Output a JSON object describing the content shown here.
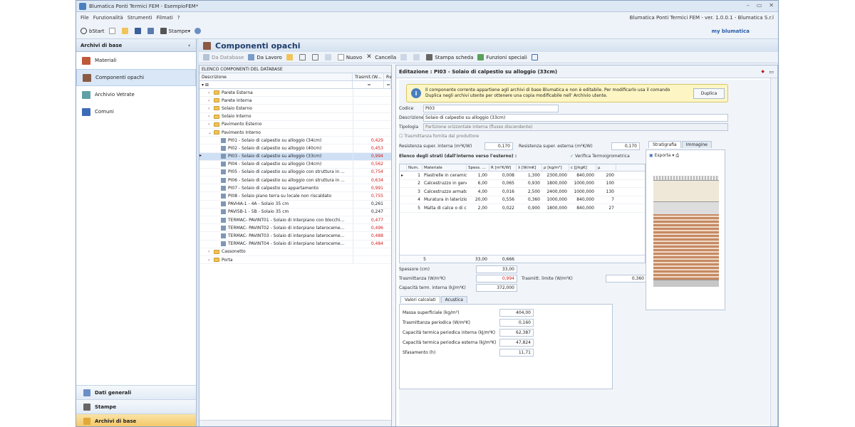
{
  "window": {
    "title": "Blumatica Ponti Termici FEM - EsempioFEM*",
    "app_info": "Blumatica Ponti Termici FEM - ver. 1.0.0.1 - Blumatica S.r.l"
  },
  "menu": [
    "File",
    "Funzionalità",
    "Strumenti",
    "Filmati",
    "?"
  ],
  "toolbar": {
    "bstart": "bStart",
    "stampe": "Stampe",
    "brand": "my blumatica"
  },
  "left": {
    "header": "Archivi di base",
    "items": [
      "Materiali",
      "Componenti opachi",
      "Archivio Vetrate",
      "Comuni"
    ],
    "bottom": [
      "Dati generali",
      "Stampe",
      "Archivi di base"
    ]
  },
  "main": {
    "title": "Componenti opachi",
    "tools": [
      "Da Database",
      "Da Lavoro",
      "Nuovo",
      "Cancella",
      "Stampa scheda",
      "Funzioni speciali"
    ]
  },
  "grid": {
    "title": "ELENCO COMPONENTI DEL DATABASE",
    "col_desc": "Descrizione",
    "col_val": "Trasmit.(W...",
    "col_rv": "Rv",
    "filter_val": "=",
    "rows": [
      {
        "t": "Parete Esterna",
        "v": "",
        "lvl": 0,
        "red": false
      },
      {
        "t": "Parete Interna",
        "v": "",
        "lvl": 0,
        "red": false
      },
      {
        "t": "Solaio Esterno",
        "v": "",
        "lvl": 0,
        "red": false
      },
      {
        "t": "Solaio Interno",
        "v": "",
        "lvl": 0,
        "red": false
      },
      {
        "t": "Pavimento Esterno",
        "v": "",
        "lvl": 0,
        "red": false
      },
      {
        "t": "Pavimento Interno",
        "v": "",
        "lvl": 0,
        "red": false
      },
      {
        "t": "PI01 - Solaio di calpestio su alloggio (34cm)",
        "v": "0,429",
        "lvl": 1,
        "red": true
      },
      {
        "t": "PI02 - Solaio di calpestio su alloggio (40cm)",
        "v": "0,453",
        "lvl": 1,
        "red": true
      },
      {
        "t": "PI03 - Solaio di calpestio su alloggio (33cm)",
        "v": "0,994",
        "lvl": 1,
        "red": true,
        "sel": true
      },
      {
        "t": "PI04 - Solaio di calpestio su alloggio (34cm)",
        "v": "0,562",
        "lvl": 1,
        "red": true
      },
      {
        "t": "PI05 - Solaio di calpestio su alloggio con struttura in ...",
        "v": "0,754",
        "lvl": 1,
        "red": true
      },
      {
        "t": "PI06 - Solaio di calpestio su alloggio con struttura in ...",
        "v": "0,634",
        "lvl": 1,
        "red": true
      },
      {
        "t": "PI07 - Solaio di calpestio su appartamento",
        "v": "0,991",
        "lvl": 1,
        "red": true
      },
      {
        "t": "PI08 - Solaio piano terra su locale non riscaldato",
        "v": "0,755",
        "lvl": 1,
        "red": true
      },
      {
        "t": "PAVI4A-1 - 4A - Solaio 35 cm",
        "v": "0,261",
        "lvl": 1,
        "red": false
      },
      {
        "t": "PAVI5B-1 - 5B - Solaio 35 cm",
        "v": "0,247",
        "lvl": 1,
        "red": false
      },
      {
        "t": "TERMAC- PAVINT01 - Solaio di interpiano con blocchi...",
        "v": "0,477",
        "lvl": 1,
        "red": true
      },
      {
        "t": "TERMAC- PAVINT02 - Solaio di interpiano lateroceme...",
        "v": "0,496",
        "lvl": 1,
        "red": true
      },
      {
        "t": "TERMAC- PAVINT03 - Solaio di interpiano lateroceme...",
        "v": "0,488",
        "lvl": 1,
        "red": true
      },
      {
        "t": "TERMAC- PAVINT04 - Solaio di interpiano lateroceme...",
        "v": "0,484",
        "lvl": 1,
        "red": true
      },
      {
        "t": "Cassonetto",
        "v": "",
        "lvl": 0,
        "red": false
      },
      {
        "t": "Porta",
        "v": "",
        "lvl": 0,
        "red": false
      }
    ]
  },
  "edit": {
    "header": "Editazione : PI03 - Solaio di calpestio su alloggio (33cm)",
    "info": "Il componente corrente appartiene agli archivi di base Blumatica e non è editabile. Per modificarlo usa il comando Duplica negli archivi utente per ottenere una copia modificabile nell' Archivio utente.",
    "duplica": "Duplica",
    "codice_label": "Codice",
    "codice": "PI03",
    "descr_label": "Descrizione",
    "descr": "Solaio di calpestio su alloggio (33cm)",
    "tipologia_label": "Tipologia",
    "tipologia": "Partizione orizzontale interna (flusso discendente)",
    "trasm_prod": "Trasmittanza fornita dal produttore",
    "res_int_label": "Resistenza super. interna (m²K/W)",
    "res_int": "0,170",
    "res_ext_label": "Resistenza super. esterna (m²K/W)",
    "res_ext": "0,170",
    "strati_label": "Elenco degli strati  (dall'interno verso l'esterno) :",
    "verifica": "Verifica Termoigrometrica",
    "strati_cols": [
      "Num.",
      "Materiale",
      "Spess. ...",
      "R [m²K/W]",
      "λ [W/mK]",
      "ρ [kg/m³]",
      "c [J/kgK]",
      "μ"
    ],
    "strati": [
      [
        "1",
        "Piastrelle in ceramica",
        "1,00",
        "0,008",
        "1,300",
        "2300,000",
        "840,000",
        "200"
      ],
      [
        "2",
        "Calcestruzzo in genere (...",
        "6,00",
        "0,065",
        "0,930",
        "1800,000",
        "1000,000",
        "100"
      ],
      [
        "3",
        "Calcestruzzo armato (co...",
        "4,00",
        "0,016",
        "2,500",
        "2400,000",
        "1000,000",
        "130"
      ],
      [
        "4",
        "Muratura in laterizio par...",
        "20,00",
        "0,556",
        "0,360",
        "1000,000",
        "840,000",
        "7"
      ],
      [
        "5",
        "Malta di calce o di calce ...",
        "2,00",
        "0,022",
        "0,900",
        "1800,000",
        "840,000",
        "27"
      ]
    ],
    "foot_count": "5",
    "foot_spess": "33,00",
    "foot_r": "0,666",
    "spessore_label": "Spessore (cm)",
    "spessore": "33,00",
    "trasmittanza_label": "Trasmittanza (W/m²K)",
    "trasmittanza": "0,994",
    "trasm_lim_label": "Trasmitt. limite (W/m²K)",
    "trasm_lim": "0,360",
    "capacita_label": "Capacità term. interna (kJ/m²K)",
    "capacita": "372,000",
    "tabs": [
      "Valori calcolati",
      "Acustica"
    ],
    "valori": [
      [
        "Massa superficiale (kg/m²)",
        "404,00"
      ],
      [
        "Trasmittanza periodica (W/m²K)",
        "0,160"
      ],
      [
        "Capacità termica periodica interna (kJ/m²K)",
        "62,387"
      ],
      [
        "Capacità termica periodica esterna (kJ/m²K)",
        "47,824"
      ],
      [
        "Sfasamento (h)",
        "11,71"
      ]
    ],
    "strat_tabs": [
      "Stratigrafia",
      "Immagine"
    ],
    "esporta": "Esporta"
  }
}
